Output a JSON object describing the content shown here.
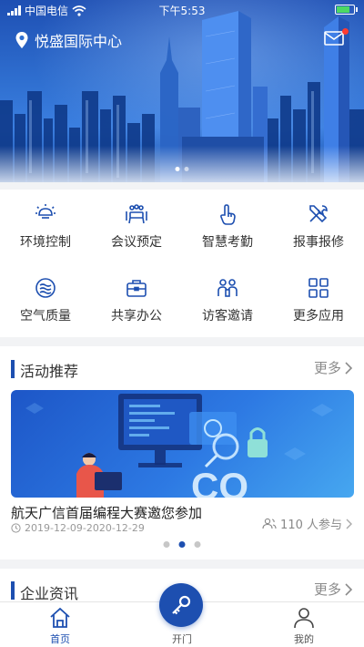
{
  "status_bar": {
    "carrier": "中国电信",
    "time": "下午5:53"
  },
  "header": {
    "location": "悦盛国际中心"
  },
  "grid": [
    {
      "label": "环境控制",
      "icon": "lamp-icon"
    },
    {
      "label": "会议预定",
      "icon": "meeting-icon"
    },
    {
      "label": "智慧考勤",
      "icon": "hand-pointer-icon"
    },
    {
      "label": "报事报修",
      "icon": "repair-tools-icon"
    },
    {
      "label": "空气质量",
      "icon": "air-quality-icon"
    },
    {
      "label": "共享办公",
      "icon": "briefcase-icon"
    },
    {
      "label": "访客邀请",
      "icon": "visitors-icon"
    },
    {
      "label": "更多应用",
      "icon": "apps-grid-icon"
    }
  ],
  "activity": {
    "title": "活动推荐",
    "more": "更多",
    "banner_text": "CO",
    "event_title": "航天广信首届编程大赛邀您参加",
    "event_date": "2019-12-09-2020-12-29",
    "participants": "110 人参与"
  },
  "news": {
    "title": "企业资讯",
    "more": "更多"
  },
  "tabbar": {
    "home": "首页",
    "open": "开门",
    "mine": "我的"
  },
  "colors": {
    "accent": "#1d4fb0",
    "badge": "#ff3b30"
  }
}
